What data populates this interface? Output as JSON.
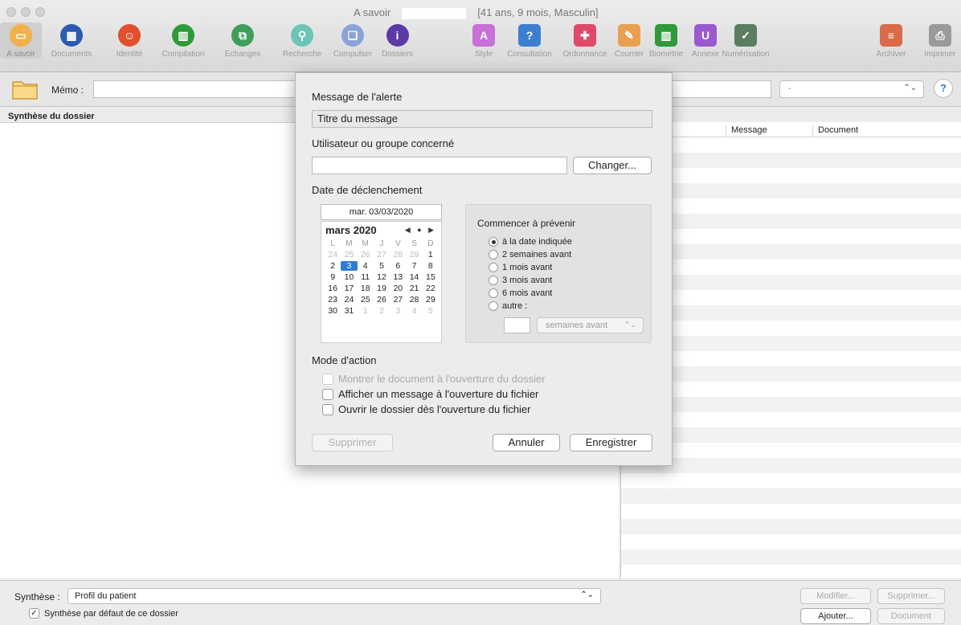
{
  "window": {
    "title": "A savoir",
    "patient_info": "[41 ans, 9 mois, Masculin]"
  },
  "toolbar": {
    "items": [
      {
        "label": "A savoir",
        "color": "#f1b04a",
        "glyph": "▭"
      },
      {
        "label": "Documents",
        "color": "#2a5bb0",
        "glyph": "▦"
      },
      {
        "label": "Identité",
        "color": "#e0502a",
        "glyph": "☺"
      },
      {
        "label": "Compilation",
        "color": "#2e9a3a",
        "glyph": "▥"
      },
      {
        "label": "Echanges",
        "color": "#3f9f5a",
        "glyph": "⧉"
      },
      {
        "label": "Recherche",
        "color": "#6cc4b6",
        "glyph": "⚲"
      },
      {
        "label": "Compulser",
        "color": "#8aa3d8",
        "glyph": "❏"
      },
      {
        "label": "Dossiers",
        "color": "#5b3aa6",
        "glyph": "i"
      },
      {
        "label": "Style",
        "color": "#c770d6",
        "glyph": "A"
      },
      {
        "label": "Consultation",
        "color": "#3d7fcf",
        "glyph": "?"
      },
      {
        "label": "Ordonnance",
        "color": "#e04a6a",
        "glyph": "✚"
      },
      {
        "label": "Courrier",
        "color": "#e8a050",
        "glyph": "✎"
      },
      {
        "label": "Biométrie",
        "color": "#2e9a3a",
        "glyph": "▥"
      },
      {
        "label": "Annexe",
        "color": "#9b59d0",
        "glyph": "U"
      },
      {
        "label": "Numérisation",
        "color": "#5b7d60",
        "glyph": "✓"
      },
      {
        "label": "Archiver",
        "color": "#d96a4a",
        "glyph": "≡"
      },
      {
        "label": "Imprimer",
        "color": "#9a9a9a",
        "glyph": "⎙"
      }
    ]
  },
  "memo": {
    "label": "Mémo :",
    "value": "",
    "select_value": "-"
  },
  "left": {
    "header": "Synthèse du dossier"
  },
  "right_table": {
    "columns": [
      "Message",
      "Document"
    ]
  },
  "bottom": {
    "synth_label": "Synthèse :",
    "synth_value": "Profil du patient",
    "default_check": "Synthèse par défaut de ce dossier",
    "buttons": {
      "modifier": "Modifier...",
      "supprimer": "Supprimer...",
      "ajouter": "Ajouter...",
      "document": "Document"
    }
  },
  "dialog": {
    "message_label": "Message de l'alerte",
    "message_value": "Titre du message",
    "user_label": "Utilisateur ou groupe concerné",
    "user_value": "",
    "change_button": "Changer...",
    "date_label": "Date de déclenchement",
    "date_value": "mar. 03/03/2020",
    "calendar": {
      "month": "mars 2020",
      "nav": "◀ ● ▶",
      "dow": [
        "L",
        "M",
        "M",
        "J",
        "V",
        "S",
        "D"
      ],
      "days": [
        {
          "d": "24",
          "o": true
        },
        {
          "d": "25",
          "o": true
        },
        {
          "d": "26",
          "o": true
        },
        {
          "d": "27",
          "o": true
        },
        {
          "d": "28",
          "o": true
        },
        {
          "d": "29",
          "o": true
        },
        {
          "d": "1"
        },
        {
          "d": "2"
        },
        {
          "d": "3",
          "sel": true
        },
        {
          "d": "4"
        },
        {
          "d": "5"
        },
        {
          "d": "6"
        },
        {
          "d": "7"
        },
        {
          "d": "8"
        },
        {
          "d": "9"
        },
        {
          "d": "10"
        },
        {
          "d": "11"
        },
        {
          "d": "12"
        },
        {
          "d": "13"
        },
        {
          "d": "14"
        },
        {
          "d": "15"
        },
        {
          "d": "16"
        },
        {
          "d": "17"
        },
        {
          "d": "18"
        },
        {
          "d": "19"
        },
        {
          "d": "20"
        },
        {
          "d": "21"
        },
        {
          "d": "22"
        },
        {
          "d": "23"
        },
        {
          "d": "24"
        },
        {
          "d": "25"
        },
        {
          "d": "26"
        },
        {
          "d": "27"
        },
        {
          "d": "28"
        },
        {
          "d": "29"
        },
        {
          "d": "30"
        },
        {
          "d": "31"
        },
        {
          "d": "1",
          "o": true
        },
        {
          "d": "2",
          "o": true
        },
        {
          "d": "3",
          "o": true
        },
        {
          "d": "4",
          "o": true
        },
        {
          "d": "5",
          "o": true
        }
      ]
    },
    "warn": {
      "title": "Commencer à prévenir",
      "options": [
        {
          "label": "à la date indiquée",
          "selected": true
        },
        {
          "label": "2 semaines avant",
          "selected": false
        },
        {
          "label": "1 mois avant",
          "selected": false
        },
        {
          "label": "3 mois avant",
          "selected": false
        },
        {
          "label": "6 mois avant",
          "selected": false
        },
        {
          "label": "autre :",
          "selected": false
        }
      ],
      "other_value": "",
      "unit_select": "semaines avant"
    },
    "mode_label": "Mode d'action",
    "mode_options": [
      {
        "label": "Montrer le document à l'ouverture du dossier",
        "disabled": true
      },
      {
        "label": "Afficher un message à l'ouverture du fichier",
        "disabled": false
      },
      {
        "label": "Ouvrir le dossier dès l'ouverture du fichier",
        "disabled": false
      }
    ],
    "buttons": {
      "delete": "Supprimer",
      "cancel": "Annuler",
      "save": "Enregistrer"
    }
  }
}
